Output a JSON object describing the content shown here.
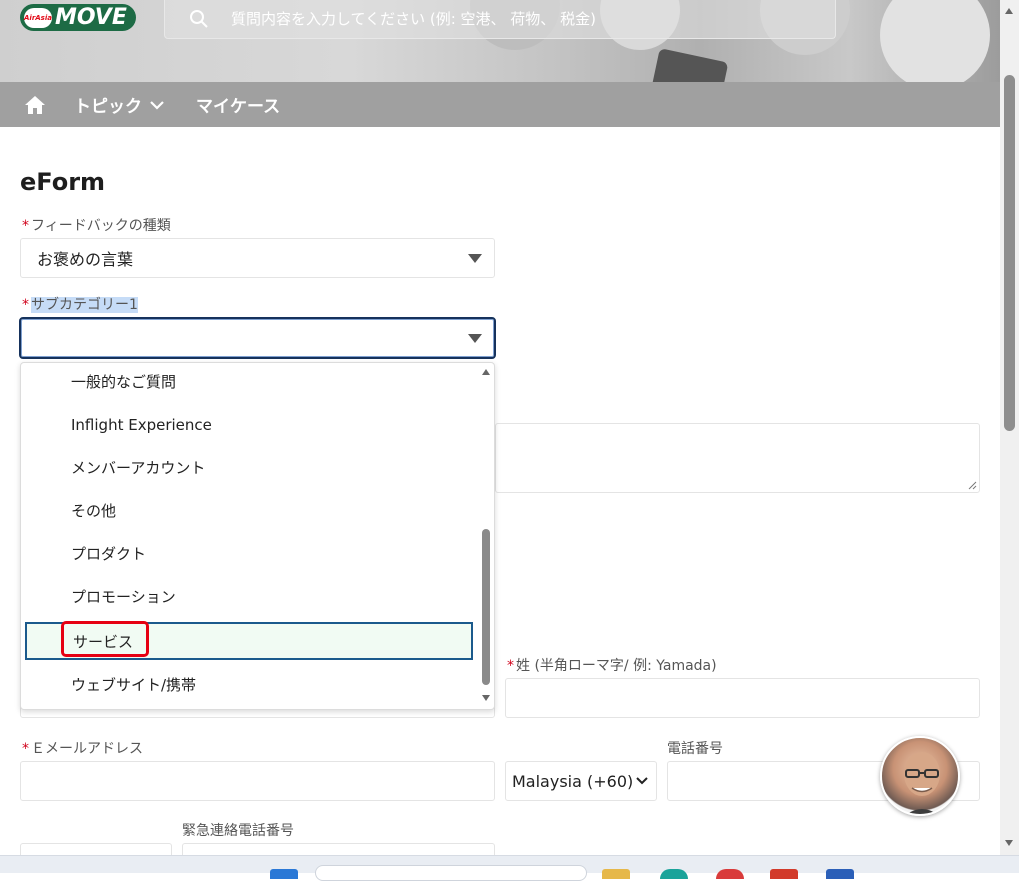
{
  "header": {
    "logo_brand": "AirAsia",
    "logo_word": "MOVE",
    "search_placeholder": "質問内容を入力してください (例: 空港、 荷物、 税金)"
  },
  "nav": {
    "home_icon": "home-icon",
    "topic_label": "トピック",
    "mycase_label": "マイケース"
  },
  "form": {
    "title": "eForm",
    "feedback_type_label": "フィードバックの種類",
    "feedback_type_value": "お褒めの言葉",
    "subcategory_label": "サブカテゴリー1",
    "subcategory_value": "",
    "lastname_label": "姓 (半角ローマ字/ 例: Yamada)",
    "email_label": "Ｅメールアドレス",
    "phone_label": "電話番号",
    "phone_country": "Malaysia (+60)",
    "emergency_label": "緊急連絡電話番号"
  },
  "dropdown": {
    "items": [
      {
        "label": "一般的なご質問"
      },
      {
        "label": "Inflight Experience"
      },
      {
        "label": "メンバーアカウント"
      },
      {
        "label": "その他"
      },
      {
        "label": "プロダクト"
      },
      {
        "label": "プロモーション"
      },
      {
        "label": "サービス"
      },
      {
        "label": "ウェブサイト/携帯"
      }
    ],
    "active_index": 6
  },
  "colors": {
    "required": "#d0021b",
    "nav_bg": "#a0a0a0",
    "logo_bg": "#1d6b45",
    "focus_border": "#16325c",
    "annotation_red": "#e60012"
  }
}
